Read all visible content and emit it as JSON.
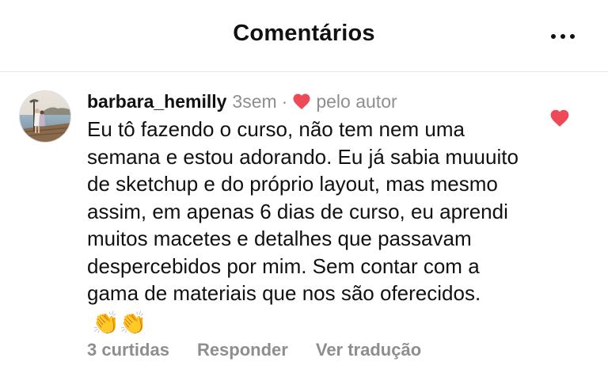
{
  "header": {
    "title": "Comentários",
    "more_icon": "more-horizontal-icon"
  },
  "comment": {
    "username": "barbara_hemilly",
    "age": "3sem",
    "separator": "·",
    "liked_by_author_label": "pelo autor",
    "text": "Eu tô fazendo o curso, não tem nem uma semana e estou adorando. Eu já sabia muuuito de sketchup e do próprio layout, mas mesmo assim, em apenas 6 dias de curso, eu aprendi muitos macetes e detalhes que passavam despercebidos por mim. Sem contar com a gama de materiais que nos são oferecidos.",
    "emoji": "👏👏",
    "liked": true
  },
  "actions": {
    "likes": "3 curtidas",
    "reply": "Responder",
    "translate": "Ver tradução"
  },
  "colors": {
    "heart": "#ed4956",
    "muted_text": "#8e8e8e",
    "text": "#111111",
    "divider": "#e6e6e6"
  }
}
